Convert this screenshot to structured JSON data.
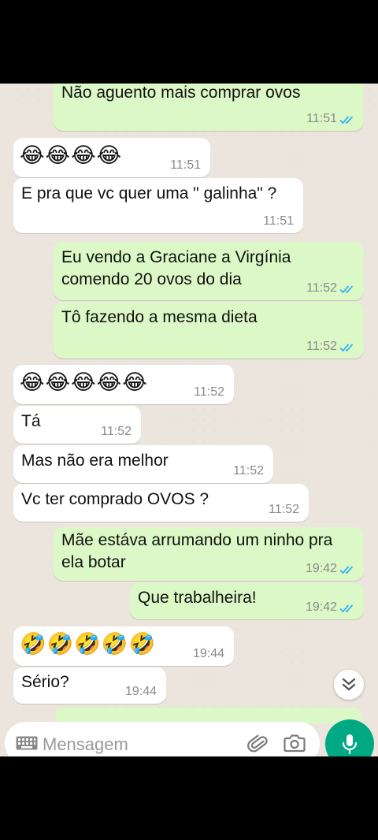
{
  "messages": [
    {
      "dir": "out",
      "text": "Não aguento mais comprar ovos",
      "time": "11:51"
    },
    {
      "dir": "in",
      "text": "😂😂😂😂",
      "time": "11:51"
    },
    {
      "dir": "in",
      "text": "E pra que vc quer uma \" galinha\" ?",
      "time": "11:51"
    },
    {
      "dir": "out",
      "text": "Eu vendo a Graciane a Virgínia\ncomendo 20 ovos do dia",
      "time": "11:52"
    },
    {
      "dir": "out",
      "text": "Tô fazendo a mesma dieta",
      "time": "11:52"
    },
    {
      "dir": "in",
      "text": "😂😂😂😂😂",
      "time": "11:52"
    },
    {
      "dir": "in",
      "text": "Tá",
      "time": "11:52"
    },
    {
      "dir": "in",
      "text": "Mas não era melhor",
      "time": "11:52"
    },
    {
      "dir": "in",
      "text": "Vc ter comprado OVOS ?",
      "time": "11:52"
    },
    {
      "dir": "out",
      "text": "Mãe  estáva arrumando um ninho pra\nela botar",
      "time": "19:42"
    },
    {
      "dir": "out",
      "text": "Que trabalheira!",
      "time": "19:42"
    },
    {
      "dir": "in",
      "text": "🤣🤣🤣🤣🤣",
      "time": "19:44"
    },
    {
      "dir": "in",
      "text": "Sério?",
      "time": "19:44"
    }
  ],
  "input": {
    "placeholder": "Mensagem"
  },
  "icons": {
    "keyboard": "keyboard-icon",
    "attach": "paperclip-icon",
    "camera": "camera-icon",
    "mic": "microphone-icon",
    "scroll": "double-chevron-down-icon"
  },
  "colors": {
    "incoming": "#FFFFFF",
    "outgoing": "#DCF8C6",
    "background": "#ECE5DD",
    "accent": "#00A884",
    "read_ticks": "#34B7F1"
  }
}
